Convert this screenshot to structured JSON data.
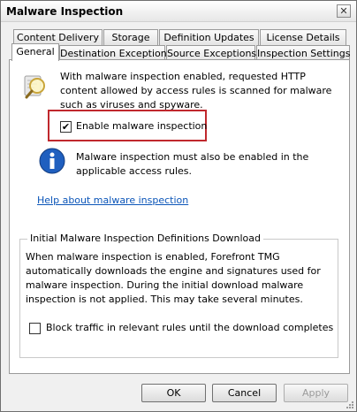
{
  "window": {
    "title": "Malware Inspection",
    "close_glyph": "✕"
  },
  "tabs": {
    "row1": [
      "Content Delivery",
      "Storage",
      "Definition Updates",
      "License Details"
    ],
    "row2": [
      "General",
      "Destination Exceptions",
      "Source Exceptions",
      "Inspection Settings"
    ],
    "active": "General"
  },
  "general": {
    "intro_text": "With malware inspection enabled, requested HTTP content allowed by access rules is scanned for malware such as viruses and spyware.",
    "enable_checkbox": {
      "label": "Enable malware inspection",
      "checked": true
    },
    "note_text": "Malware inspection must also be enabled in the applicable access rules.",
    "help_link": "Help about malware inspection",
    "download_group": {
      "title": "Initial Malware Inspection Definitions Download",
      "description": "When malware inspection is enabled, Forefront TMG automatically downloads the engine and signatures used for malware inspection. During the initial download malware inspection is not applied. This may take several minutes.",
      "block_checkbox": {
        "label": "Block traffic in relevant rules until the download completes",
        "checked": false
      }
    }
  },
  "buttons": {
    "ok": "OK",
    "cancel": "Cancel",
    "apply": "Apply"
  },
  "icons": [
    "scan-magnifier-icon",
    "info-icon",
    "close-icon",
    "checkmark-icon",
    "resize-grip-icon"
  ],
  "colors": {
    "highlight_border": "#c0282d",
    "link": "#0b55b8",
    "info_icon": "#1f5fbf"
  }
}
